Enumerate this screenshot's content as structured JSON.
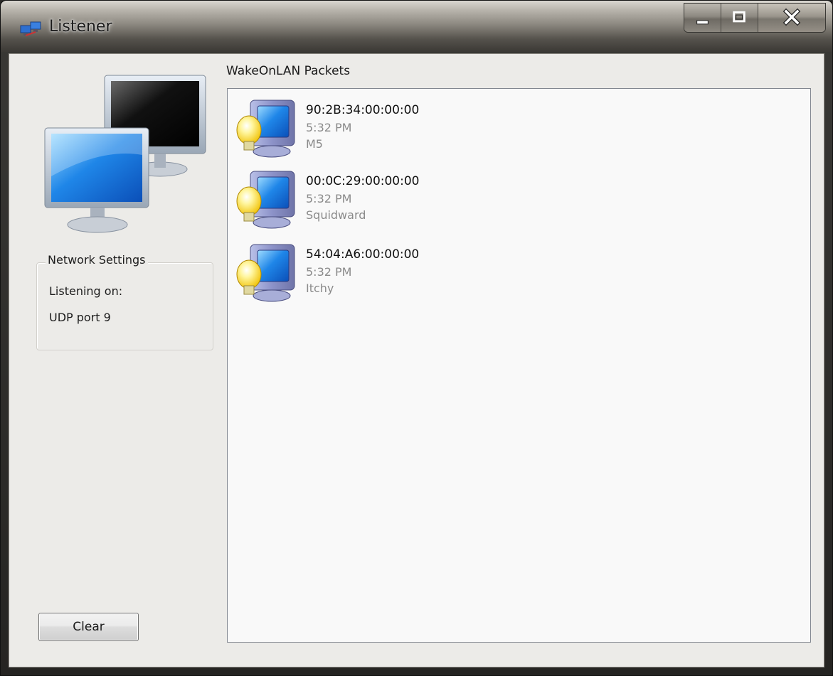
{
  "window": {
    "title": "Listener",
    "caption_buttons": [
      "minimize-icon",
      "maximize-icon",
      "close-icon"
    ]
  },
  "sidebar": {
    "image": "networked-computers-image",
    "network_settings": {
      "title": "Network Settings",
      "line1": "Listening on:",
      "line2": "UDP port 9"
    },
    "clear_label": "Clear"
  },
  "packets": {
    "label": "WakeOnLAN Packets",
    "items": [
      {
        "mac": "90:2B:34:00:00:00",
        "time": "5:32 PM",
        "name": "M5",
        "icon": "computer-lightbulb-icon"
      },
      {
        "mac": "00:0C:29:00:00:00",
        "time": "5:32 PM",
        "name": "Squidward",
        "icon": "computer-lightbulb-icon"
      },
      {
        "mac": "54:04:A6:00:00:00",
        "time": "5:32 PM",
        "name": "Itchy",
        "icon": "computer-lightbulb-icon"
      }
    ]
  }
}
